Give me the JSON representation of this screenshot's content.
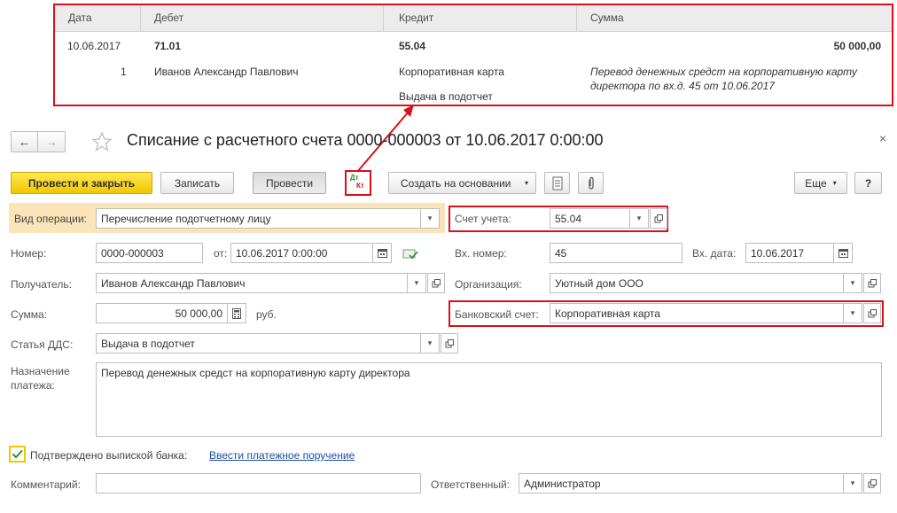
{
  "posting": {
    "headers": {
      "date": "Дата",
      "debit": "Дебет",
      "credit": "Кредит",
      "amount": "Сумма"
    },
    "row": {
      "date": "10.06.2017",
      "debit_account": "71.01",
      "credit_account": "55.04",
      "amount": "50 000,00",
      "line_no": "1",
      "debit_subconto": "Иванов Александр Павлович",
      "credit_subconto1": "Корпоративная карта",
      "credit_subconto2": "Выдача в подотчет",
      "content_line1": "Перевод денежных средст на корпоративную карту",
      "content_line2": "директора по вх.д. 45 от 10.06.2017"
    }
  },
  "window": {
    "title": "Списание с расчетного счета 0000-000003 от 10.06.2017 0:00:00",
    "close": "×"
  },
  "toolbar": {
    "post_close": "Провести и закрыть",
    "save": "Записать",
    "post": "Провести",
    "dtkt_top": "Дт",
    "dtkt_bottom": "Кт",
    "create_based": "Создать на основании",
    "more": "Еще",
    "help": "?"
  },
  "form": {
    "operation_label": "Вид операции:",
    "operation_value": "Перечисление подотчетному лицу",
    "account_label": "Счет учета:",
    "account_value": "55.04",
    "number_label": "Номер:",
    "number_value": "0000-000003",
    "from_label": "от:",
    "from_value": "10.06.2017  0:00:00",
    "in_number_label": "Вх. номер:",
    "in_number_value": "45",
    "in_date_label": "Вх. дата:",
    "in_date_value": "10.06.2017",
    "recipient_label": "Получатель:",
    "recipient_value": "Иванов Александр Павлович",
    "org_label": "Организация:",
    "org_value": "Уютный дом ООО",
    "sum_label": "Сумма:",
    "sum_value": "50 000,00",
    "currency": "руб.",
    "bank_label": "Банковский счет:",
    "bank_value": "Корпоративная карта",
    "dds_label": "Статья ДДС:",
    "dds_value": "Выдача в подотчет",
    "purpose_label_1": "Назначение",
    "purpose_label_2": "платежа:",
    "purpose_value": "Перевод денежных средст на корпоративную карту директора",
    "confirmed_label": "Подтверждено выпиской банка:",
    "confirmed_checked": true,
    "payment_order_link": "Ввести платежное поручение",
    "comment_label": "Комментарий:",
    "comment_value": "",
    "responsible_label": "Ответственный:",
    "responsible_value": "Администратор"
  },
  "colors": {
    "highlight": "#d9101b",
    "primary_button": "#f5d31c",
    "operation_bg": "#fbe5b8",
    "link": "#1c4fa6"
  }
}
